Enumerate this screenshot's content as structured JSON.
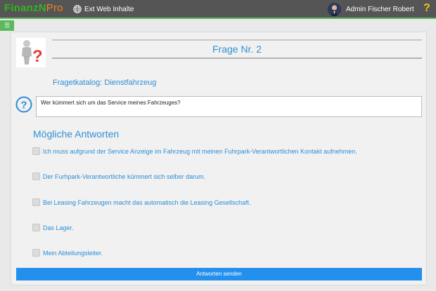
{
  "header": {
    "logo_part1": "FinanzN",
    "logo_part2": "Pro",
    "ext_link": "Ext Web Inhalte",
    "user_name": "Admin Fischer Robert",
    "help_symbol": "?"
  },
  "menu": {
    "symbol": "☰"
  },
  "quiz": {
    "title": "Frage Nr. 2",
    "catalog": "Fragetkatalog: Dienstfahrzeug",
    "question": "Wer kümmert sich um das Service meines Fahrzeuges?",
    "answers_title": "Mögliche Antworten",
    "answers": [
      {
        "label": "Ich muss aufgrund der Service Anzeige im Fahrzeug mit meinen Fuhrpark-Verantwortlichen Kontakt aufnehmen.",
        "checked": false
      },
      {
        "label": "Der Furhpark-Verantwortliche kümmert sich selber darum.",
        "checked": false
      },
      {
        "label": "Bei Leasing Fahrzeugen macht das automatisch die Leasing Gesellschaft.",
        "checked": false
      },
      {
        "label": "Das Lager.",
        "checked": false
      },
      {
        "label": "Mein Abteilungsleiter.",
        "checked": false
      }
    ],
    "submit_label": "Antworten senden"
  },
  "icons": {
    "globe": "globe-icon",
    "question_person": "question-person-icon",
    "question_circle": "question-circle-icon"
  },
  "colors": {
    "header_bg": "#555555",
    "accent_green": "#5cb85c",
    "text_blue": "#2b8ed6",
    "button_blue": "#2490ee",
    "help_yellow": "#f4c21b"
  }
}
